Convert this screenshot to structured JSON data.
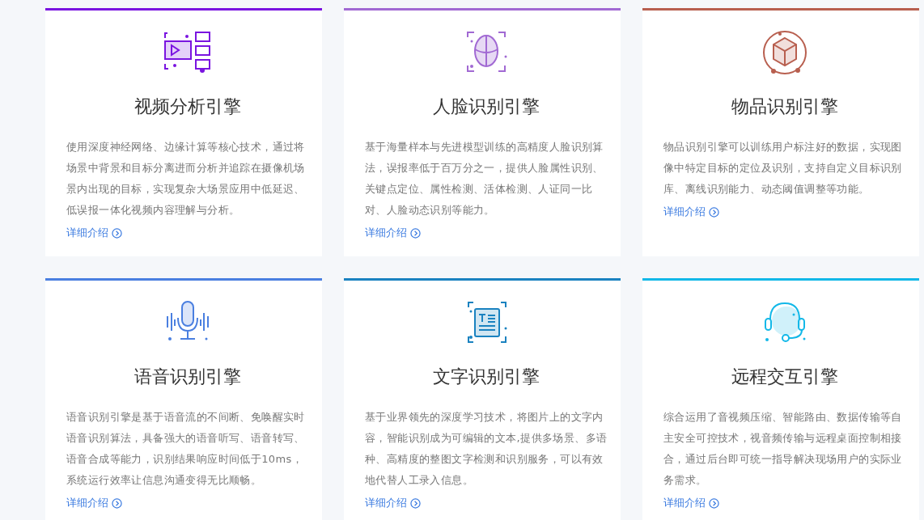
{
  "cards": [
    {
      "kind": "video",
      "color": "#7a14e0",
      "title": "视频分析引擎",
      "description": "使用深度神经网络、边缘计算等核心技术，通过将场景中背景和目标分离进而分析并追踪在摄像机场景内出现的目标，实现复杂大场景应用中低延迟、低误报一体化视频内容理解与分析。",
      "link": "详细介绍"
    },
    {
      "kind": "face",
      "color": "#a169d3",
      "title": "人脸识别引擎",
      "description": "基于海量样本与先进模型训练的高精度人脸识别算法，误报率低于百万分之一，提供人脸属性识别、关键点定位、属性检测、活体检测、人证同一比对、人脸动态识别等能力。",
      "link": "详细介绍"
    },
    {
      "kind": "object",
      "color": "#b85f4f",
      "title": "物品识别引擎",
      "description": "物品识别引擎可以训练用户标注好的数据，实现图像中特定目标的定位及识别，支持自定义目标识别库、离线识别能力、动态阈值调整等功能。",
      "link": "详细介绍"
    },
    {
      "kind": "voice",
      "color": "#4a7fe0",
      "title": "语音识别引擎",
      "description": "语音识别引擎是基于语音流的不间断、免唤醒实时语音识别算法，具备强大的语音听写、语音转写、语音合成等能力，识别结果响应时间低于10ms，系统运行效率让信息沟通变得无比顺畅。",
      "link": "详细介绍"
    },
    {
      "kind": "text",
      "color": "#1a82c0",
      "title": "文字识别引擎",
      "description": "基于业界领先的深度学习技术，将图片上的文字内容，智能识别成为可编辑的文本,提供多场景、多语种、高精度的整图文字检测和识别服务，可以有效地代替人工录入信息。",
      "link": "详细介绍"
    },
    {
      "kind": "remote",
      "color": "#12b8e8",
      "title": "远程交互引擎",
      "description": "综合运用了音视频压缩、智能路由、数据传输等自主安全可控技术，视音频传输与远程桌面控制相接合，通过后台即可统一指导解决现场用户的实际业务需求。",
      "link": "详细介绍"
    }
  ]
}
